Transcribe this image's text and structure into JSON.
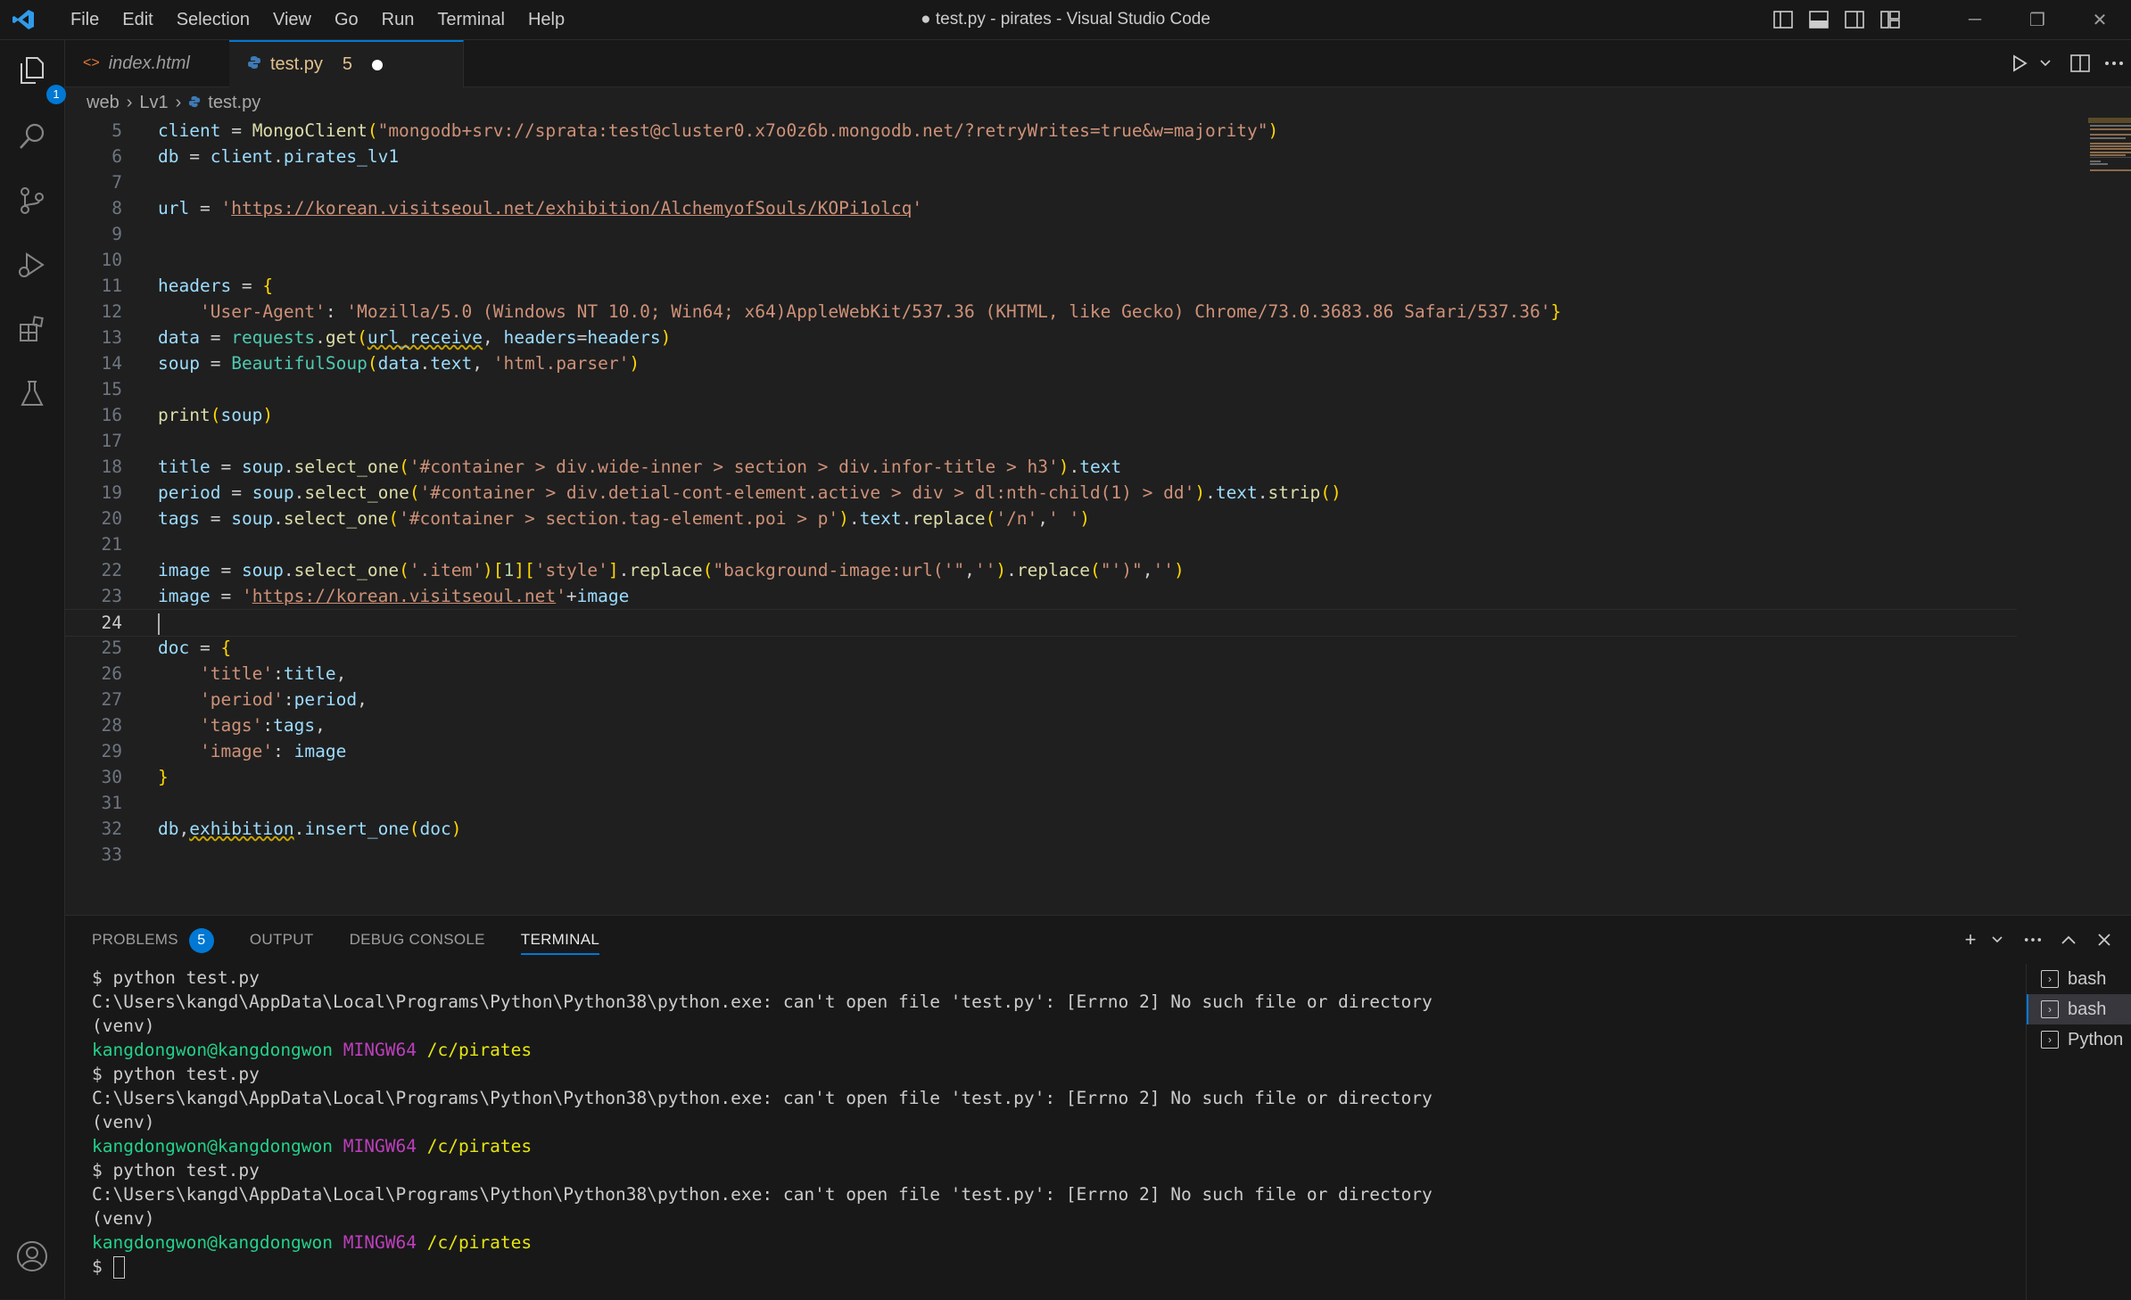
{
  "window": {
    "title": "● test.py - pirates - Visual Studio Code",
    "menu": [
      "File",
      "Edit",
      "Selection",
      "View",
      "Go",
      "Run",
      "Terminal",
      "Help"
    ],
    "controls": [
      "─",
      "❐",
      "✕"
    ]
  },
  "activity_bar": {
    "explorer_badge": "1",
    "icons": [
      "files-icon",
      "search-icon",
      "source-control-icon",
      "run-debug-icon",
      "extensions-icon",
      "testing-icon",
      "account-icon"
    ]
  },
  "tabs": [
    {
      "label": "index.html",
      "icon": "<>",
      "active": false
    },
    {
      "label": "test.py",
      "icon": "python-icon",
      "problems": "5",
      "active": true,
      "dirty": true
    }
  ],
  "breadcrumb": [
    "web",
    "Lv1",
    "test.py"
  ],
  "editor": {
    "current_line": 24,
    "lines": [
      {
        "n": "5"
      },
      {
        "n": "6"
      },
      {
        "n": "7"
      },
      {
        "n": "8"
      },
      {
        "n": "9"
      },
      {
        "n": "10"
      },
      {
        "n": "11"
      },
      {
        "n": "12"
      },
      {
        "n": "13"
      },
      {
        "n": "14"
      },
      {
        "n": "15"
      },
      {
        "n": "16"
      },
      {
        "n": "17"
      },
      {
        "n": "18"
      },
      {
        "n": "19"
      },
      {
        "n": "20"
      },
      {
        "n": "21"
      },
      {
        "n": "22"
      },
      {
        "n": "23"
      },
      {
        "n": "24"
      },
      {
        "n": "25"
      },
      {
        "n": "26"
      },
      {
        "n": "27"
      },
      {
        "n": "28"
      },
      {
        "n": "29"
      },
      {
        "n": "30"
      },
      {
        "n": "31"
      },
      {
        "n": "32"
      },
      {
        "n": "33"
      }
    ],
    "code": {
      "l5_var": "client",
      "l5_fn": "MongoClient",
      "l5_str": "\"mongodb+srv://sprata:test@cluster0.x7o0z6b.mongodb.net/?retryWrites=true&w=majority\"",
      "l6_a": "db",
      "l6_b": "client",
      "l6_c": "pirates_lv1",
      "l8_var": "url",
      "l8_str": "https://korean.visitseoul.net/exhibition/AlchemyofSouls/KOPi1olcq",
      "l11_var": "headers",
      "l12_key": "'User-Agent'",
      "l12_val": "'Mozilla/5.0 (Windows NT 10.0; Win64; x64)AppleWebKit/537.36 (KHTML, like Gecko) Chrome/73.0.3683.86 Safari/537.36'",
      "l13_var": "data",
      "l13_mod": "requests",
      "l13_fn": "get",
      "l13_arg1": "url_receive",
      "l13_kw": "headers",
      "l13_val": "headers",
      "l14_var": "soup",
      "l14_cls": "BeautifulSoup",
      "l14_a": "data",
      "l14_b": "text",
      "l14_str": "'html.parser'",
      "l16_fn": "print",
      "l16_arg": "soup",
      "l18_var": "title",
      "l18_obj": "soup",
      "l18_fn": "select_one",
      "l18_str": "'#container > div.wide-inner > section > div.infor-title > h3'",
      "l18_attr": "text",
      "l19_var": "period",
      "l19_obj": "soup",
      "l19_fn": "select_one",
      "l19_str": "'#container > div.detial-cont-element.active > div > dl:nth-child(1) > dd'",
      "l19_attr": "text",
      "l19_fn2": "strip",
      "l20_var": "tags",
      "l20_obj": "soup",
      "l20_fn": "select_one",
      "l20_str": "'#container > section.tag-element.poi > p'",
      "l20_attr": "text",
      "l20_fn2": "replace",
      "l20_s1": "'/n'",
      "l20_s2": "' '",
      "l22_var": "image",
      "l22_obj": "soup",
      "l22_fn": "select_one",
      "l22_s1": "'.item'",
      "l22_idx": "1",
      "l22_s2": "'style'",
      "l22_fn2": "replace",
      "l22_s3": "\"background-image:url('\"",
      "l22_s4": "''",
      "l22_s5": "\"')\"",
      "l22_s6": "''",
      "l23_var": "image",
      "l23_str": "https://korean.visitseoul.net",
      "l23_var2": "image",
      "l25_var": "doc",
      "l26_key": "'title'",
      "l26_val": "title",
      "l27_key": "'period'",
      "l27_val": "period",
      "l28_key": "'tags'",
      "l28_val": "tags",
      "l29_key": "'image'",
      "l29_val": "image",
      "l32_a": "db",
      "l32_b": "exhibition",
      "l32_fn": "insert_one",
      "l32_arg": "doc"
    }
  },
  "panel": {
    "tabs": [
      "PROBLEMS",
      "OUTPUT",
      "DEBUG CONSOLE",
      "TERMINAL"
    ],
    "problems_count": "5",
    "active_tab": "TERMINAL",
    "terminal": {
      "cmd": "$ python test.py",
      "error": "C:\\Users\\kangd\\AppData\\Local\\Programs\\Python\\Python38\\python.exe: can't open file 'test.py': [Errno 2] No such file or directory",
      "venv": "(venv)",
      "user": "kangdongwon@kangdongwon",
      "shell": "MINGW64",
      "path": "/c/pirates",
      "prompt": "$"
    },
    "terminal_list": [
      "bash",
      "bash",
      "Python"
    ],
    "selected_terminal": 1
  },
  "colors": {
    "accent": "#0078d4",
    "background": "#1f1f1f"
  }
}
